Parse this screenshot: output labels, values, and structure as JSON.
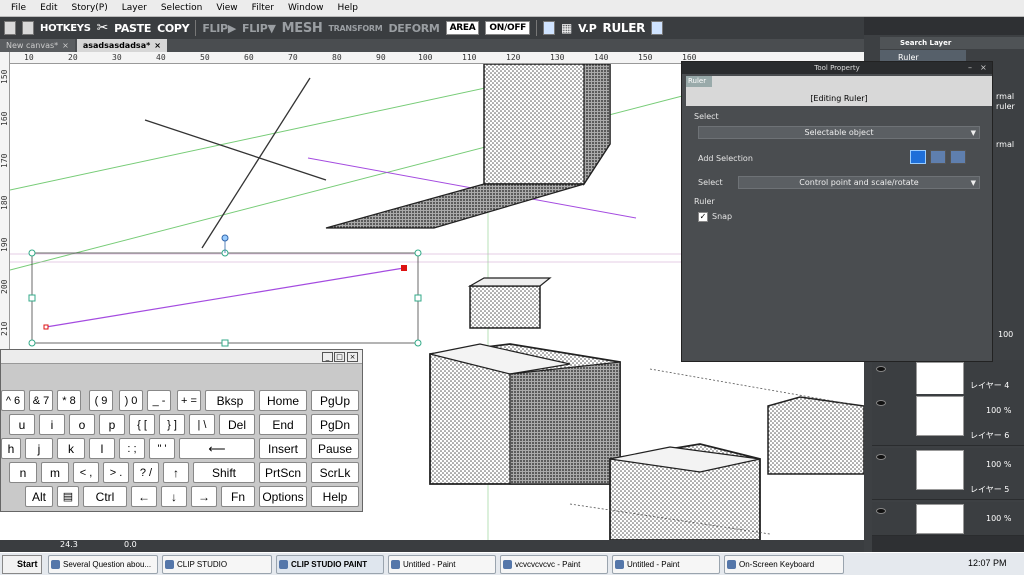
{
  "menu": {
    "items": [
      "File",
      "Edit",
      "Story(P)",
      "Layer",
      "Selection",
      "View",
      "Filter",
      "Window",
      "Help"
    ]
  },
  "command_bar": {
    "hotkeys": "HOTKEYS",
    "paste": "PASTE",
    "copy": "COPY",
    "flip_h": "FLIP▶",
    "flip_v": "FLIP▼",
    "mesh": "MESH",
    "transform": "TRANSFORM",
    "deform": "DEFORM",
    "area": "AREA",
    "onoff": "ON/OFF",
    "vp": "V.P",
    "ruler": "RULER"
  },
  "tabs": [
    {
      "label": "New canvas*",
      "active": false
    },
    {
      "label": "asadsasdadsa*",
      "active": true
    }
  ],
  "hruler": [
    "10",
    "20",
    "30",
    "40",
    "50",
    "60",
    "70",
    "80",
    "90",
    "100",
    "110",
    "120",
    "130",
    "140",
    "150",
    "160"
  ],
  "vruler": [
    "150",
    "160",
    "170",
    "180",
    "190",
    "200",
    "210"
  ],
  "right_panel": {
    "search_layer": "Search Layer",
    "ruler_layer": "Ruler",
    "side_labels": [
      "rmal",
      "ruler",
      "rmal"
    ],
    "opacity_top": "100",
    "layers": [
      {
        "name": "レイヤー 4",
        "opacity": ""
      },
      {
        "name": "レイヤー 6",
        "opacity": "100 %"
      },
      {
        "name": "レイヤー 5",
        "opacity": "100 %"
      },
      {
        "name": "",
        "opacity": "100 %"
      }
    ]
  },
  "tool_property": {
    "title": "Tool Property",
    "tag": "Ruler",
    "header_label": "[Editing Ruler]",
    "select_label": "Select",
    "selectable_object": "Selectable object",
    "add_selection_label": "Add Selection",
    "select2_label": "Select",
    "select2_value": "Control point and scale/rotate",
    "ruler_label": "Ruler",
    "snap_label": "Snap",
    "snap_checked": true
  },
  "keyboard": {
    "rows": [
      [
        "^ 6",
        "& 7",
        "* 8",
        "( 9",
        ") 0",
        "_ -",
        "+ =",
        "Bksp",
        "Home",
        "PgUp"
      ],
      [
        "u",
        "i",
        "o",
        "p",
        "{ [",
        "} ]",
        "| \\",
        "Del",
        "End",
        "PgDn"
      ],
      [
        "h",
        "j",
        "k",
        "l",
        ": ;",
        "\" '",
        "⟵",
        "Insert",
        "Pause"
      ],
      [
        "n",
        "m",
        "< ,",
        "> .",
        "? /",
        "↑",
        "Shift",
        "PrtScn",
        "ScrLk"
      ],
      [
        "Alt",
        "▤",
        "Ctrl",
        "←",
        "↓",
        "→",
        "Fn",
        "Options",
        "Help"
      ]
    ]
  },
  "status": {
    "zoom": "24.3",
    "angle": "0.0"
  },
  "taskbar": {
    "start": "Start",
    "tasks": [
      {
        "label": "Several Question abou...",
        "active": false
      },
      {
        "label": "CLIP STUDIO",
        "active": false
      },
      {
        "label": "CLIP STUDIO PAINT",
        "active": true
      },
      {
        "label": "Untitled - Paint",
        "active": false
      },
      {
        "label": "vcvcvcvcvc - Paint",
        "active": false
      },
      {
        "label": "Untitled - Paint",
        "active": false
      },
      {
        "label": "On-Screen Keyboard",
        "active": false
      }
    ],
    "clock": "12:07 PM"
  }
}
